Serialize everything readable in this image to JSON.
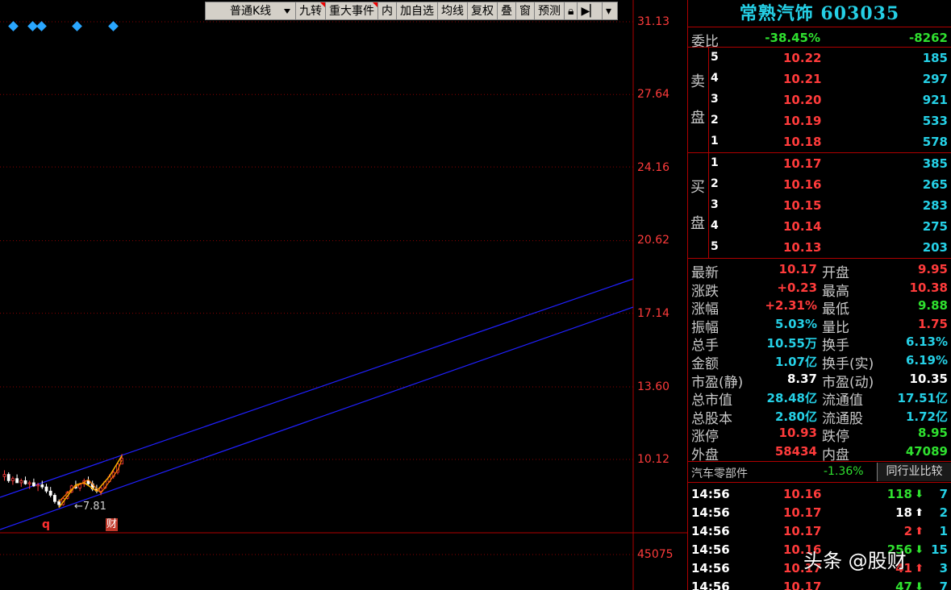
{
  "toolbar": {
    "kline_type": "普通K线",
    "buttons": [
      "九转",
      "重大事件",
      "内",
      "加自选",
      "均线",
      "复权",
      "叠",
      "窗",
      "预测"
    ]
  },
  "chart": {
    "price_levels": [
      "31.13",
      "27.64",
      "24.16",
      "20.62",
      "17.14",
      "13.60",
      "10.12"
    ],
    "volume_level": "45075",
    "low_label": "7.81",
    "event_q": "q",
    "event_cai": "财"
  },
  "stock": {
    "name": "常熟汽饰",
    "code": "603035",
    "title": "常熟汽饰 603035"
  },
  "weibi": {
    "label": "委比",
    "pct": "-38.45%",
    "diff": "-8262"
  },
  "sell": {
    "label": [
      "卖",
      "盘"
    ],
    "levels": [
      {
        "n": "5",
        "price": "10.22",
        "qty": "185"
      },
      {
        "n": "4",
        "price": "10.21",
        "qty": "297"
      },
      {
        "n": "3",
        "price": "10.20",
        "qty": "921"
      },
      {
        "n": "2",
        "price": "10.19",
        "qty": "533"
      },
      {
        "n": "1",
        "price": "10.18",
        "qty": "578"
      }
    ]
  },
  "buy": {
    "label": [
      "买",
      "盘"
    ],
    "levels": [
      {
        "n": "1",
        "price": "10.17",
        "qty": "385"
      },
      {
        "n": "2",
        "price": "10.16",
        "qty": "265"
      },
      {
        "n": "3",
        "price": "10.15",
        "qty": "283"
      },
      {
        "n": "4",
        "price": "10.14",
        "qty": "275"
      },
      {
        "n": "5",
        "price": "10.13",
        "qty": "203"
      }
    ]
  },
  "quote": [
    {
      "k1": "最新",
      "v1": "10.17",
      "c1": "red",
      "k2": "开盘",
      "v2": "9.95",
      "c2": "red"
    },
    {
      "k1": "涨跌",
      "v1": "+0.23",
      "c1": "red",
      "k2": "最高",
      "v2": "10.38",
      "c2": "red"
    },
    {
      "k1": "涨幅",
      "v1": "+2.31%",
      "c1": "red",
      "k2": "最低",
      "v2": "9.88",
      "c2": "green"
    },
    {
      "k1": "振幅",
      "v1": "5.03%",
      "c1": "cyan",
      "k2": "量比",
      "v2": "1.75",
      "c2": "red"
    },
    {
      "k1": "总手",
      "v1": "10.55万",
      "c1": "cyan",
      "k2": "换手",
      "v2": "6.13%",
      "c2": "cyan"
    },
    {
      "k1": "金额",
      "v1": "1.07亿",
      "c1": "cyan",
      "k2": "换手(实)",
      "v2": "6.19%",
      "c2": "cyan"
    },
    {
      "k1": "市盈(静)",
      "v1": "8.37",
      "c1": "white",
      "k2": "市盈(动)",
      "v2": "10.35",
      "c2": "white"
    },
    {
      "k1": "总市值",
      "v1": "28.48亿",
      "c1": "cyan",
      "k2": "流通值",
      "v2": "17.51亿",
      "c2": "cyan"
    },
    {
      "k1": "总股本",
      "v1": "2.80亿",
      "c1": "cyan",
      "k2": "流通股",
      "v2": "1.72亿",
      "c2": "cyan"
    },
    {
      "k1": "涨停",
      "v1": "10.93",
      "c1": "red",
      "k2": "跌停",
      "v2": "8.95",
      "c2": "green"
    },
    {
      "k1": "外盘",
      "v1": "58434",
      "c1": "red",
      "k2": "内盘",
      "v2": "47089",
      "c2": "green"
    }
  ],
  "sector": {
    "name": "汽车零部件",
    "pct": "-1.36%",
    "compare_label": "同行业比较"
  },
  "ticks": [
    {
      "time": "14:56",
      "price": "10.16",
      "vol": "118",
      "dir": "down",
      "count": "7"
    },
    {
      "time": "14:56",
      "price": "10.17",
      "vol": "18",
      "dir": "neutral",
      "count": "2"
    },
    {
      "time": "14:56",
      "price": "10.17",
      "vol": "2",
      "dir": "up",
      "count": "1"
    },
    {
      "time": "14:56",
      "price": "10.16",
      "vol": "256",
      "dir": "down",
      "count": "15"
    },
    {
      "time": "14:56",
      "price": "10.17",
      "vol": "41",
      "dir": "up",
      "count": "3"
    },
    {
      "time": "14:56",
      "price": "10.17",
      "vol": "47",
      "dir": "down",
      "count": "7"
    }
  ],
  "watermark": "头条 @股财",
  "colors": {
    "up": "#ff3b3b",
    "down": "#2fe02f",
    "info": "#25d0e6",
    "channel": "#2020ff",
    "grid": "#8b0000"
  }
}
